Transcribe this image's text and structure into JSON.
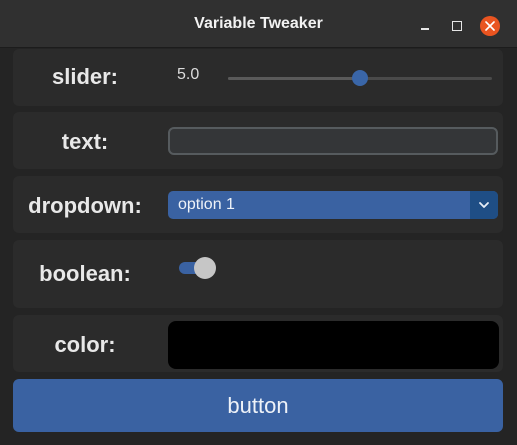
{
  "window": {
    "title": "Variable Tweaker"
  },
  "slider": {
    "label": "slider:",
    "value_text": "5.0",
    "value": 5.0,
    "fraction": 0.5
  },
  "text": {
    "label": "text:",
    "value": "",
    "placeholder": ""
  },
  "dropdown": {
    "label": "dropdown:",
    "selected": "option 1"
  },
  "boolean": {
    "label": "boolean:",
    "checked": true
  },
  "color": {
    "label": "color:",
    "value": "#000000"
  },
  "button": {
    "label": "button"
  },
  "theme": {
    "accent": "#3a62a2",
    "background": "#242424",
    "panel": "#2b2b2b"
  }
}
